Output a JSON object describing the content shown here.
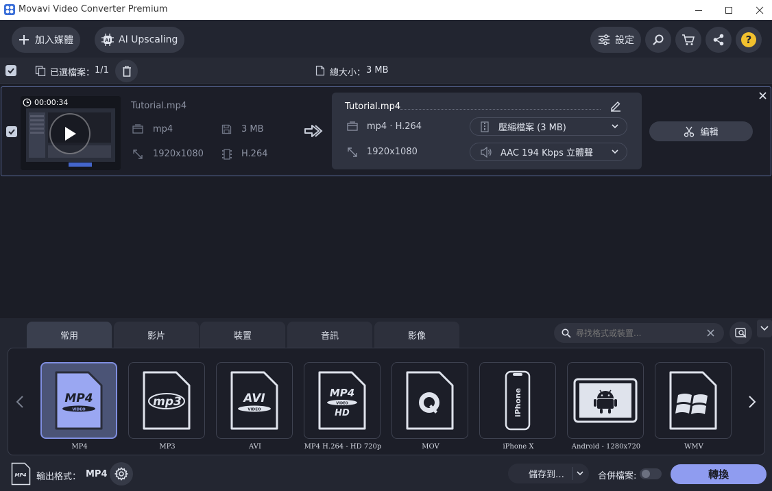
{
  "window": {
    "title": "Movavi Video Converter Premium"
  },
  "toolbar": {
    "add_media_label": "加入媒體",
    "ai_upscaling_label": "AI Upscaling",
    "settings_label": "設定"
  },
  "selection_bar": {
    "selected_label": "已選檔案：",
    "selected_count": "1/1",
    "total_size_label": "總大小：",
    "total_size_value": "3 MB"
  },
  "file": {
    "duration": "00:00:34",
    "name": "Tutorial.mp4",
    "format": "mp4",
    "size": "3 MB",
    "resolution": "1920x1080",
    "codec": "H.264",
    "output": {
      "name": "Tutorial.mp4",
      "format": "mp4 · H.264",
      "resolution": "1920x1080",
      "compress_label": "壓縮檔案 (3 MB)",
      "audio_label": "AAC 194 Kbps 立體聲"
    },
    "edit_label": "編輯"
  },
  "tabs": [
    "常用",
    "影片",
    "裝置",
    "音訊",
    "影像"
  ],
  "search": {
    "placeholder": "尋找格式或裝置..."
  },
  "formats": [
    {
      "label": "MP4",
      "selected": true
    },
    {
      "label": "MP3",
      "selected": false
    },
    {
      "label": "AVI",
      "selected": false
    },
    {
      "label": "MP4 H.264 - HD 720p",
      "selected": false
    },
    {
      "label": "MOV",
      "selected": false
    },
    {
      "label": "iPhone X",
      "selected": false
    },
    {
      "label": "Android - 1280x720",
      "selected": false
    },
    {
      "label": "WMV",
      "selected": false
    }
  ],
  "format_icons": {
    "mp4": "MP4",
    "mp4_sub": "VIDEO",
    "mp3": "mp3",
    "avi": "AVI",
    "avi_sub": "VIDEO",
    "hd": "MP4",
    "hd_sub": "VIDEO",
    "hd_tag": "HD",
    "iphone": "iPhone"
  },
  "footer": {
    "output_format_label": "輸出格式：",
    "output_format_value": "MP4",
    "output_icon_text": "MP4",
    "save_to_label": "儲存到…",
    "merge_label": "合併檔案:",
    "convert_label": "轉換"
  },
  "colors": {
    "accent": "#8f9cf0",
    "selected_format_bg": "#4b5476",
    "background": "#1b1d26",
    "panel": "#2f3340"
  }
}
